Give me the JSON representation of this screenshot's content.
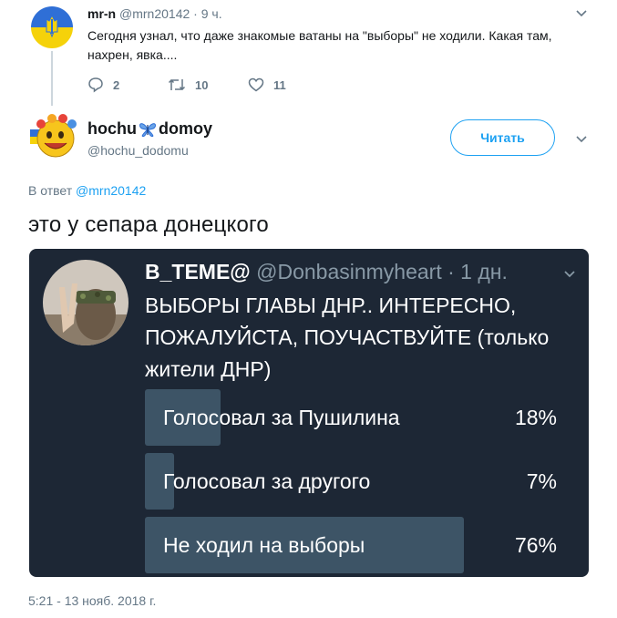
{
  "parent_tweet": {
    "name": "mr-n",
    "handle": "@mrn20142",
    "dot": "·",
    "time": "9 ч.",
    "text": "Сегодня узнал, что даже знакомые ватаны на \"выборы\" не ходили. Какая там, нахрен, явка....",
    "reply_count": "2",
    "retweet_count": "10",
    "like_count": "11",
    "avatar_icon": "ukraine-trident-flag-avatar"
  },
  "main_tweet": {
    "name_part1": "hochu",
    "name_part2": "domoy",
    "name_emoji": "butterfly-icon",
    "handle": "@hochu_dodomu",
    "follow_label": "Читать",
    "reply_prefix": "В ответ",
    "reply_handle": "@mrn20142",
    "text": "это у сепара донецкого",
    "timestamp": "5:21 - 13 нояб. 2018 г.",
    "avatar_icon": "smiley-ukraine-avatar"
  },
  "embedded": {
    "name": "B_TEME@",
    "handle": "@Donbasinmyheart",
    "dot": "·",
    "time": "1 дн.",
    "text": "ВЫБОРЫ ГЛАВЫ ДНР.. ИНТЕРЕСНО, ПОЖАЛУЙСТА, ПОУЧАСТВУЙТЕ (только жители ДНР)",
    "poll": [
      {
        "label": "Голосовал за Пушилина",
        "percent": "18%",
        "value": 18
      },
      {
        "label": "Голосовал за другого",
        "percent": "7%",
        "value": 7
      },
      {
        "label": "Не ходил на выборы",
        "percent": "76%",
        "value": 76
      }
    ]
  },
  "colors": {
    "accent": "#1da1f2",
    "muted": "#657786",
    "embed_bg": "#1d2735",
    "poll_bar": "#3d5466"
  }
}
